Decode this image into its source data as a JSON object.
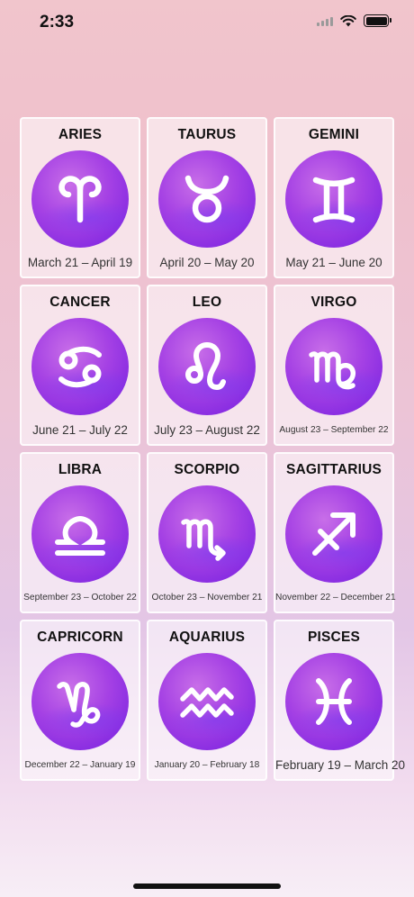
{
  "status_bar": {
    "time": "2:33"
  },
  "colors": {
    "medallion": "#a541e4",
    "glyph": "#ffffff"
  },
  "signs": [
    {
      "name": "ARIES",
      "dates": "March 21 – April 19",
      "icon": "aries-icon"
    },
    {
      "name": "TAURUS",
      "dates": "April 20 – May 20",
      "icon": "taurus-icon"
    },
    {
      "name": "GEMINI",
      "dates": "May 21 – June 20",
      "icon": "gemini-icon"
    },
    {
      "name": "CANCER",
      "dates": "June 21 – July 22",
      "icon": "cancer-icon"
    },
    {
      "name": "LEO",
      "dates": "July 23 – August 22",
      "icon": "leo-icon"
    },
    {
      "name": "VIRGO",
      "dates": "August 23 – September 22",
      "icon": "virgo-icon"
    },
    {
      "name": "LIBRA",
      "dates": "September 23 – October 22",
      "icon": "libra-icon"
    },
    {
      "name": "SCORPIO",
      "dates": "October 23 – November 21",
      "icon": "scorpio-icon"
    },
    {
      "name": "SAGITTARIUS",
      "dates": "November 22 – December 21",
      "icon": "sagittarius-icon"
    },
    {
      "name": "CAPRICORN",
      "dates": "December 22 – January 19",
      "icon": "capricorn-icon"
    },
    {
      "name": "AQUARIUS",
      "dates": "January 20 – February 18",
      "icon": "aquarius-icon"
    },
    {
      "name": "PISCES",
      "dates": "February 19 – March 20",
      "icon": "pisces-icon"
    }
  ]
}
